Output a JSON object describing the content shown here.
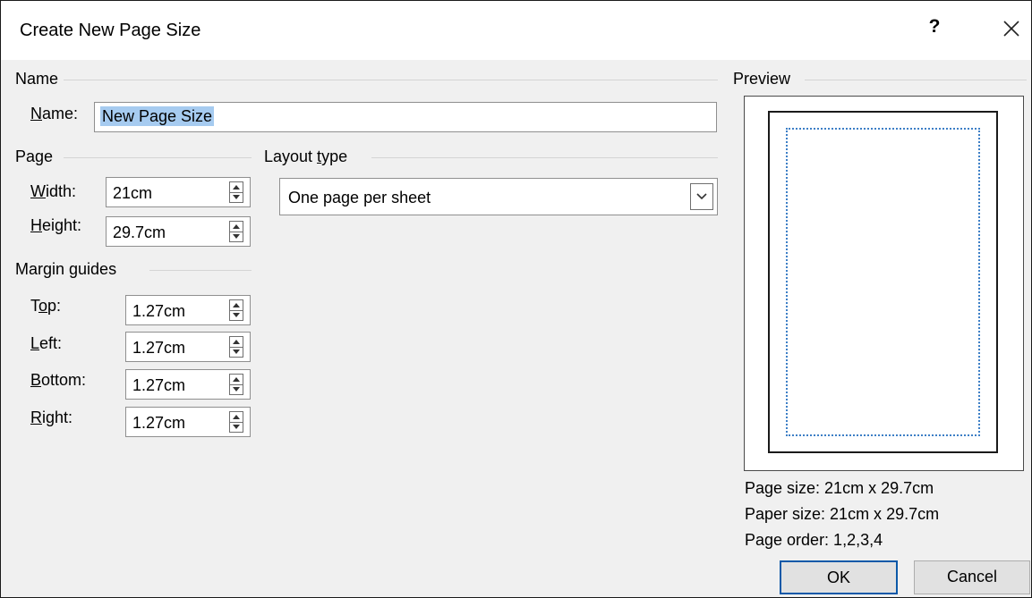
{
  "dialog": {
    "title": "Create New Page Size",
    "help_label": "?",
    "close_icon": "close-icon"
  },
  "name_group": {
    "heading": "Name",
    "label_key": "N",
    "label_rest": "ame:",
    "value": "New Page Size"
  },
  "page_group": {
    "heading": "Page",
    "width_label_key": "W",
    "width_label_rest": "idth:",
    "width_value": "21cm",
    "height_label_key": "H",
    "height_label_rest": "eight:",
    "height_value": "29.7cm"
  },
  "layout_group": {
    "heading_pre": "Layout ",
    "heading_key": "t",
    "heading_rest": "ype",
    "selected": "One page per sheet"
  },
  "margin_group": {
    "heading": "Margin guides",
    "top_label_pre": "T",
    "top_label_key": "o",
    "top_label_rest": "p:",
    "top_value": "1.27cm",
    "left_label_key": "L",
    "left_label_rest": "eft:",
    "left_value": "1.27cm",
    "bottom_label_key": "B",
    "bottom_label_rest": "ottom:",
    "bottom_value": "1.27cm",
    "right_label_key": "R",
    "right_label_rest": "ight:",
    "right_value": "1.27cm"
  },
  "preview": {
    "heading": "Preview",
    "page_size": "Page size: 21cm x 29.7cm",
    "paper_size": "Paper size: 21cm x 29.7cm",
    "page_order": "Page order: 1,2,3,4"
  },
  "buttons": {
    "ok": "OK",
    "cancel": "Cancel"
  },
  "colors": {
    "selection": "#a6cbf0",
    "default_button_border": "#0b59a8",
    "margin_guide": "#3d7fc6"
  }
}
